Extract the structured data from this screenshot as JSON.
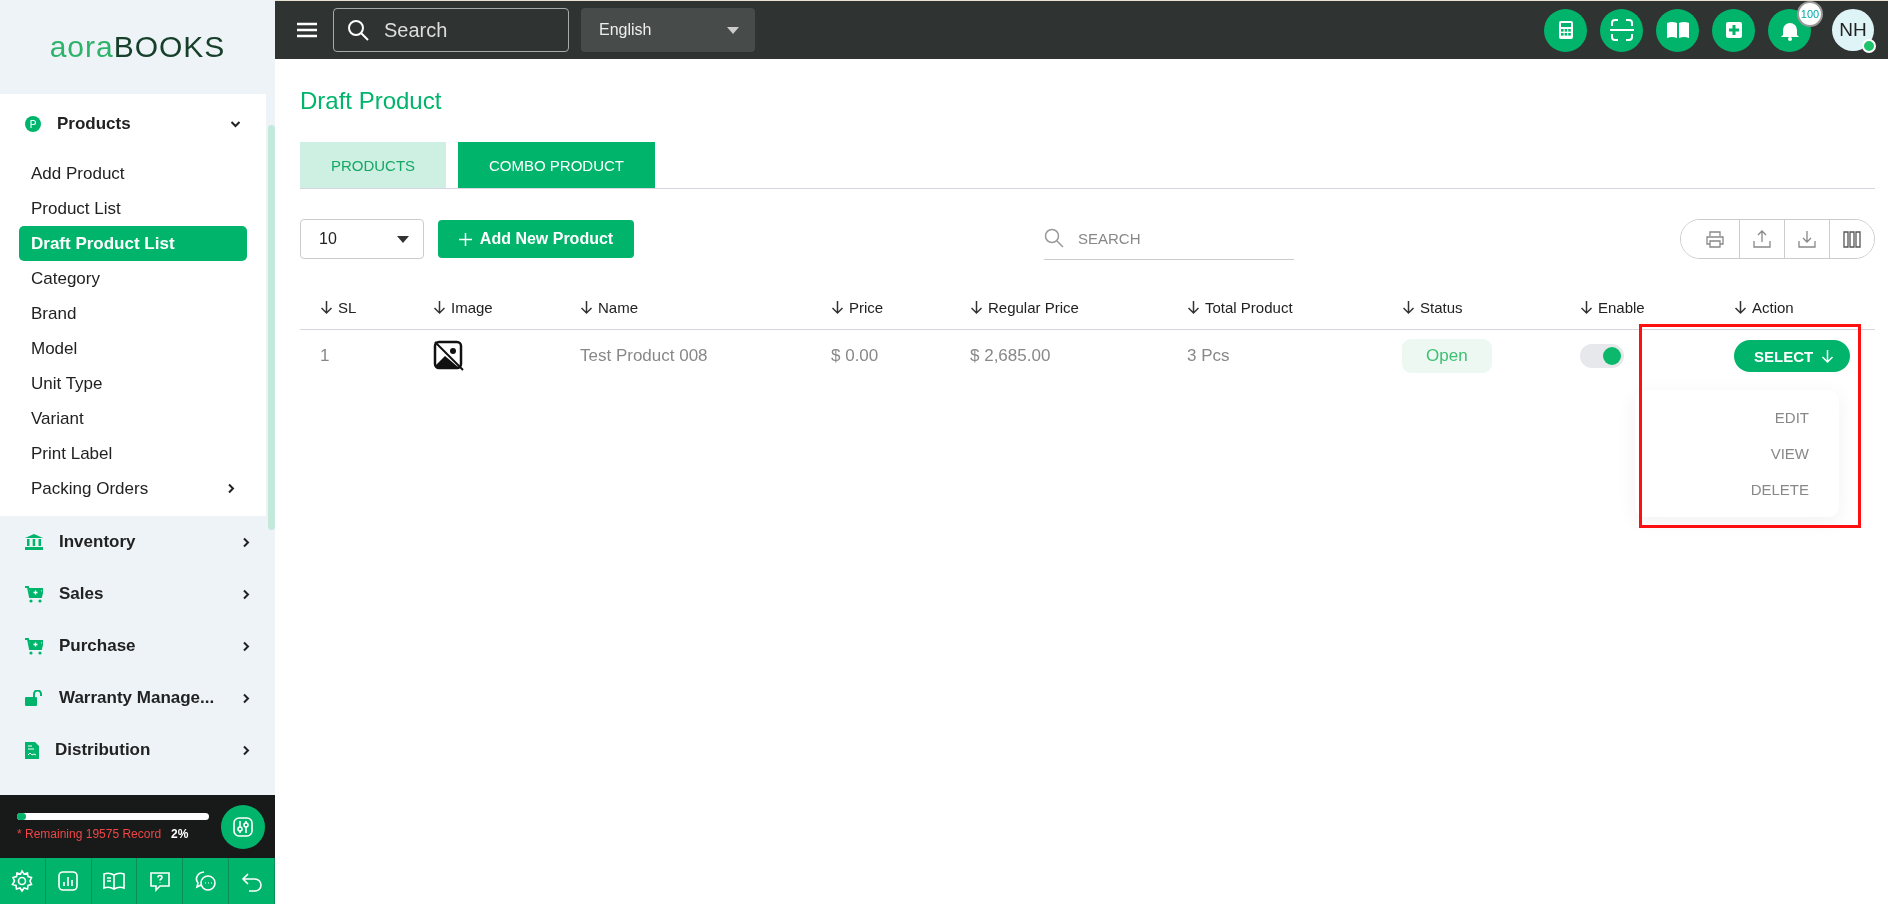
{
  "logo": {
    "lead": "aora",
    "tail": "BOOKS"
  },
  "sidebar": {
    "groups": [
      {
        "label": "Products",
        "expanded": true,
        "children": [
          {
            "label": "Add Product",
            "selected": false
          },
          {
            "label": "Product List",
            "selected": false
          },
          {
            "label": "Draft Product List",
            "selected": true
          },
          {
            "label": "Category",
            "selected": false
          },
          {
            "label": "Brand",
            "selected": false
          },
          {
            "label": "Model",
            "selected": false
          },
          {
            "label": "Unit Type",
            "selected": false
          },
          {
            "label": "Variant",
            "selected": false
          },
          {
            "label": "Print Label",
            "selected": false
          },
          {
            "label": "Packing Orders",
            "selected": false,
            "has_submenu": true
          }
        ]
      },
      {
        "label": "Inventory",
        "expanded": false
      },
      {
        "label": "Sales",
        "expanded": false
      },
      {
        "label": "Purchase",
        "expanded": false
      },
      {
        "label": "Warranty Manage...",
        "expanded": false
      },
      {
        "label": "Distribution",
        "expanded": false
      }
    ]
  },
  "usage": {
    "level": 0.02,
    "note": "* Remaining 19575 Record",
    "percent": "2%"
  },
  "topbar": {
    "search_placeholder": "Search",
    "language": "English",
    "notification_count": "100",
    "avatar": "NH"
  },
  "page": {
    "title": "Draft Product",
    "tabs": [
      {
        "label": "PRODUCTS",
        "selected": false
      },
      {
        "label": "COMBO PRODUCT",
        "selected": true
      }
    ],
    "page_size": "10",
    "add_button": "Add New Product",
    "search_placeholder": "SEARCH",
    "table": {
      "columns": [
        "SL",
        "Image",
        "Name",
        "Price",
        "Regular Price",
        "Total Product",
        "Status",
        "Enable",
        "Action"
      ],
      "rows": [
        {
          "sl": "1",
          "name": "Test Product 008",
          "price": "$ 0.00",
          "regular_price": "$ 2,685.00",
          "total": "3 Pcs",
          "status": "Open",
          "enabled": true,
          "action": "SELECT"
        }
      ]
    },
    "action_menu": [
      "EDIT",
      "VIEW",
      "DELETE"
    ]
  }
}
